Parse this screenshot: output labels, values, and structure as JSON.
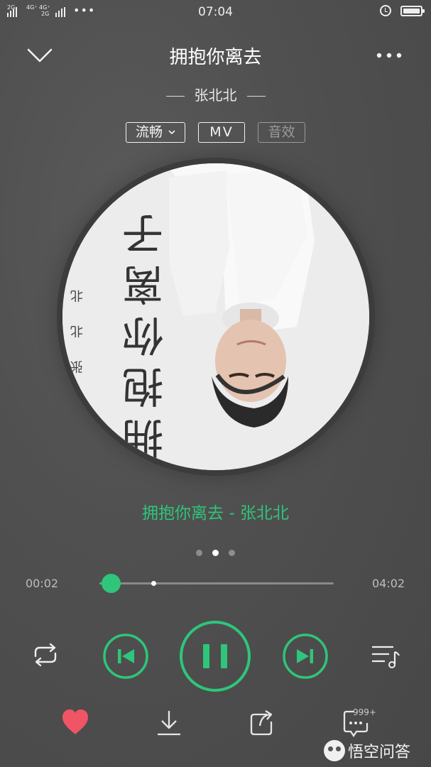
{
  "status_bar": {
    "sim1": "2G",
    "sim2_top": "4G⁺ 4G⁺",
    "sim2_bottom": "2G",
    "dots": "•••",
    "time": "07:04",
    "icons": [
      "signal-icon",
      "alarm-icon",
      "battery-icon"
    ]
  },
  "header": {
    "title": "拥抱你离去",
    "artist": "张北北",
    "back_icon": "chevron-down-icon",
    "more_icon": "more-dots-icon"
  },
  "options": {
    "quality": "流畅",
    "mv": "MV",
    "effects": "音效"
  },
  "album_art": {
    "artist_text": "张北北",
    "title_text": "拥抱你离去"
  },
  "lyric": {
    "text": "拥抱你离去 - 张北北"
  },
  "pager": {
    "count": 3,
    "active_index": 1
  },
  "playback": {
    "current_time": "00:02",
    "total_time": "04:02",
    "progress_fraction": 0.008,
    "buffered_fraction": 0.23,
    "state": "playing"
  },
  "controls": {
    "loop_icon": "repeat-icon",
    "prev_icon": "previous-icon",
    "play_icon": "pause-icon",
    "next_icon": "next-icon",
    "queue_icon": "playlist-icon"
  },
  "actions": {
    "comment_count": "999+",
    "like_icon": "heart-icon",
    "download_icon": "download-icon",
    "share_icon": "share-icon",
    "comment_icon": "comment-icon"
  },
  "watermark": {
    "text": "悟空问答"
  },
  "colors": {
    "accent": "#2fc57a",
    "like": "#f05566",
    "background": "#4f4f4f"
  }
}
